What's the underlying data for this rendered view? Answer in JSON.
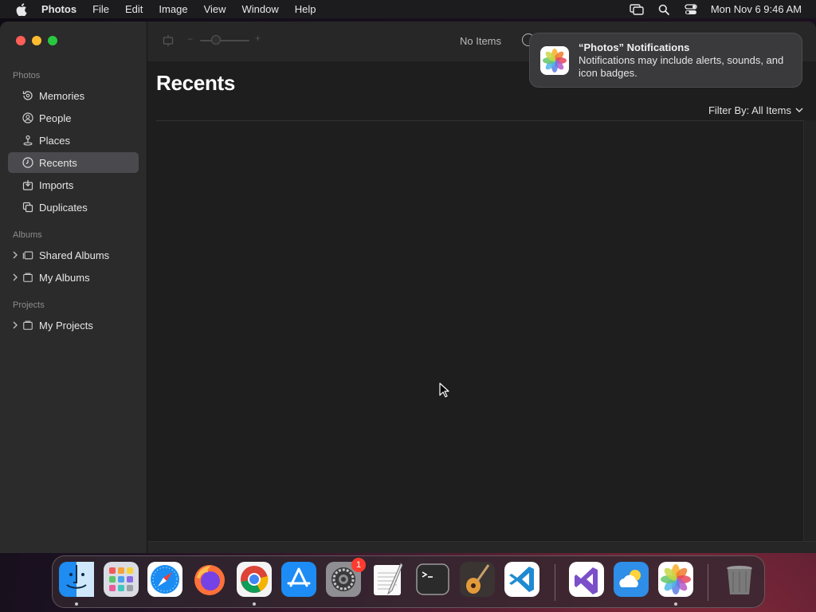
{
  "menubar": {
    "app_name": "Photos",
    "menus": [
      "File",
      "Edit",
      "Image",
      "View",
      "Window",
      "Help"
    ],
    "clock": "Mon Nov 6  9:46 AM"
  },
  "sidebar": {
    "photos_header": "Photos",
    "photos_items": [
      {
        "label": "Memories",
        "icon": "memories-icon"
      },
      {
        "label": "People",
        "icon": "people-icon"
      },
      {
        "label": "Places",
        "icon": "places-icon"
      },
      {
        "label": "Recents",
        "icon": "recents-icon",
        "selected": true
      },
      {
        "label": "Imports",
        "icon": "imports-icon"
      },
      {
        "label": "Duplicates",
        "icon": "duplicates-icon"
      }
    ],
    "albums_header": "Albums",
    "albums_items": [
      {
        "label": "Shared Albums",
        "icon": "shared-albums-icon"
      },
      {
        "label": "My Albums",
        "icon": "my-albums-icon"
      }
    ],
    "projects_header": "Projects",
    "projects_items": [
      {
        "label": "My Projects",
        "icon": "my-projects-icon"
      }
    ]
  },
  "toolbar": {
    "status": "No Items",
    "zoom_minus": "−",
    "zoom_plus": "+"
  },
  "main": {
    "title": "Recents",
    "filter_label": "Filter By: All Items"
  },
  "notification": {
    "title": "“Photos” Notifications",
    "body": "Notifications may include alerts, sounds, and icon badges."
  },
  "dock": {
    "apps": [
      {
        "name": "Finder",
        "running": true
      },
      {
        "name": "Launchpad",
        "running": false
      },
      {
        "name": "Safari",
        "running": false
      },
      {
        "name": "Firefox",
        "running": false
      },
      {
        "name": "Chrome",
        "running": true
      },
      {
        "name": "App Store",
        "running": false
      },
      {
        "name": "System Settings",
        "running": false,
        "badge": "1"
      },
      {
        "name": "TextEdit",
        "running": false
      },
      {
        "name": "Terminal",
        "running": false
      },
      {
        "name": "GarageBand",
        "running": false
      },
      {
        "name": "Visual Studio Code",
        "running": false
      },
      {
        "name": "Visual Studio",
        "running": false
      },
      {
        "name": "Weather",
        "running": false
      },
      {
        "name": "Photos",
        "running": true
      },
      {
        "name": "Trash",
        "running": false
      }
    ]
  }
}
